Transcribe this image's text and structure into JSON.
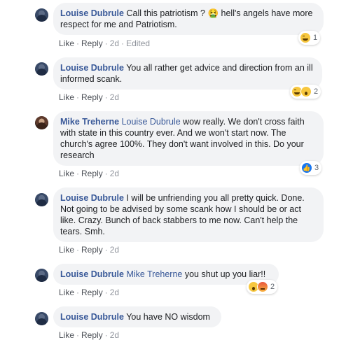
{
  "comments": [
    {
      "author": "Louise Dubrule",
      "mention": "",
      "text": "Call this patriotism ? 🤮 hell's angels have more respect for me and Patriotism.",
      "actions": {
        "like": "Like",
        "reply": "Reply",
        "time": "2d",
        "edited": "Edited"
      },
      "reactions": {
        "icons": [
          "haha"
        ],
        "count": "1"
      }
    },
    {
      "author": "Louise Dubrule",
      "mention": "",
      "text": "You all rather get advice and direction from an ill informed scank.",
      "actions": {
        "like": "Like",
        "reply": "Reply",
        "time": "2d"
      },
      "reactions": {
        "icons": [
          "haha",
          "wow"
        ],
        "count": "2"
      }
    },
    {
      "author": "Mike Treherne",
      "mention": "Louise Dubrule",
      "text": "wow really. We don't cross faith with state in this country ever. And we won't start now. The church's agree 100%. They don't want involved in this. Do your research",
      "actions": {
        "like": "Like",
        "reply": "Reply",
        "time": "2d"
      },
      "reactions": {
        "icons": [
          "like"
        ],
        "count": "3"
      }
    },
    {
      "author": "Louise Dubrule",
      "mention": "",
      "text": "I will be unfriending you all pretty quick. Done. Not going to be advised by some scank how I should be or act like. Crazy. Bunch of back stabbers to me now. Can't help the tears. Smh.",
      "actions": {
        "like": "Like",
        "reply": "Reply",
        "time": "2d"
      },
      "reactions": null
    },
    {
      "author": "Louise Dubrule",
      "mention": "Mike Treherne",
      "text": "you shut up you liar!!",
      "actions": {
        "like": "Like",
        "reply": "Reply",
        "time": "2d"
      },
      "reactions": {
        "icons": [
          "wow",
          "angry"
        ],
        "count": "2"
      }
    },
    {
      "author": "Louise Dubrule",
      "mention": "",
      "text": "You have NO wisdom",
      "actions": {
        "like": "Like",
        "reply": "Reply",
        "time": "2d"
      },
      "reactions": null
    }
  ],
  "colors": {
    "link": "#385898",
    "bubble": "#f2f3f5",
    "meta": "#606770"
  }
}
